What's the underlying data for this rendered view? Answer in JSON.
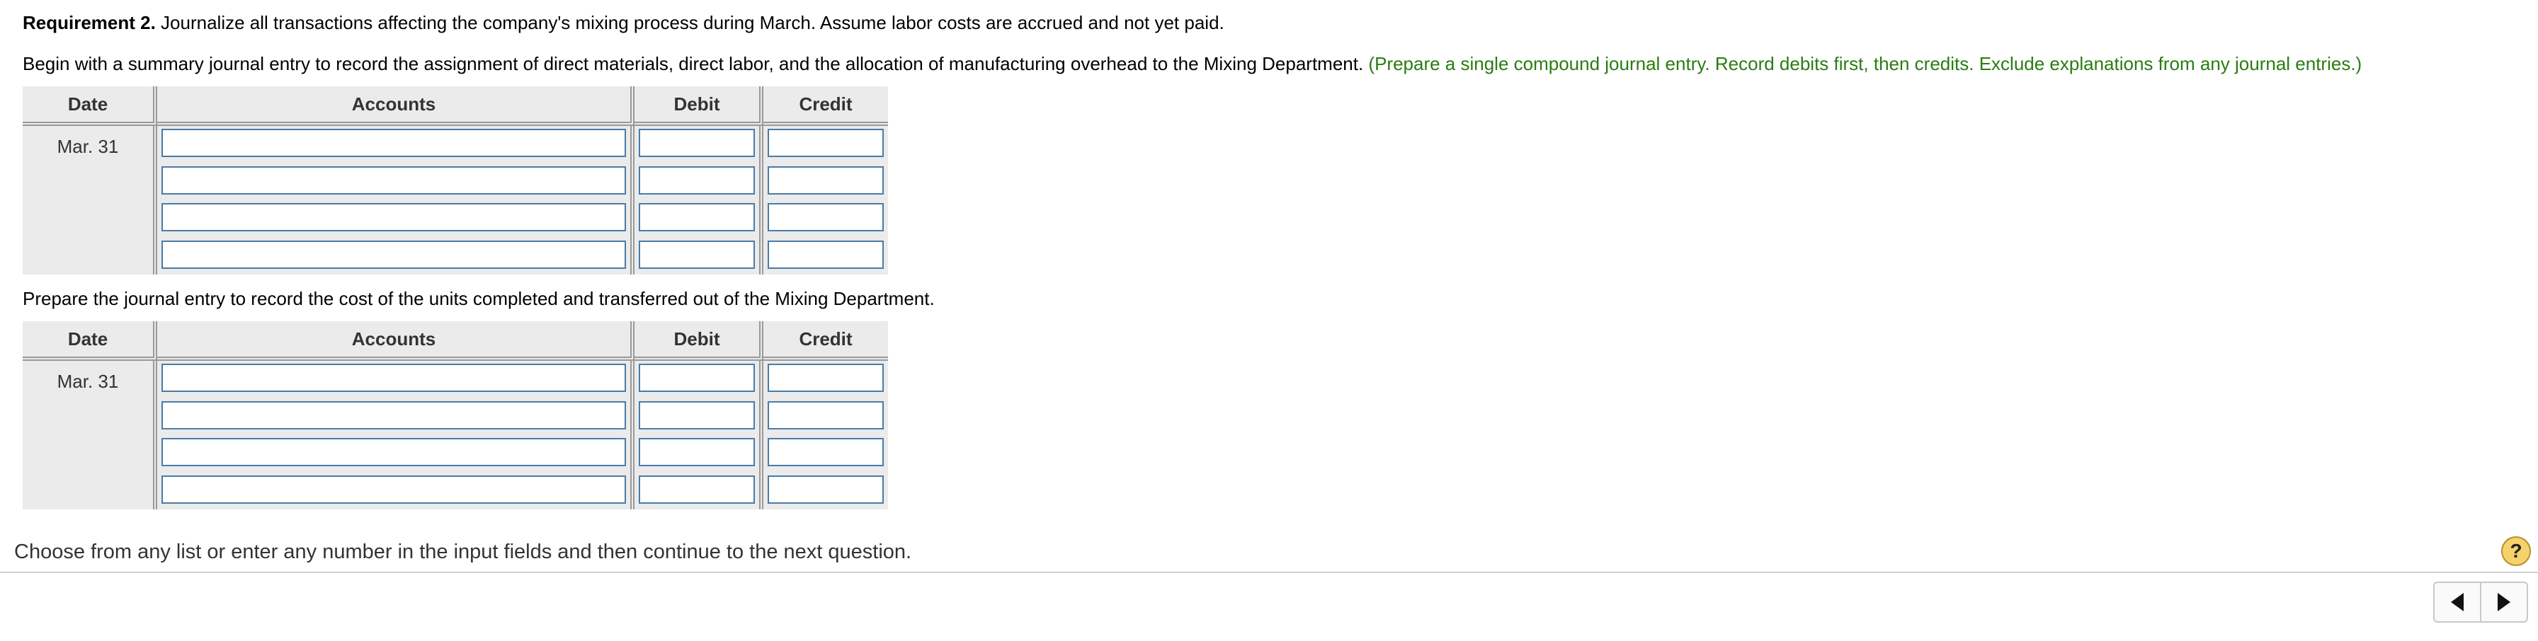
{
  "requirement": {
    "label": "Requirement 2.",
    "text": " Journalize all transactions affecting the company's mixing process during March. Assume labor costs are accrued and not yet paid."
  },
  "entry1": {
    "instruction": "Begin with a summary journal entry to record the assignment of direct materials, direct labor, and the allocation of manufacturing overhead to the Mixing Department. ",
    "hint": "(Prepare a single compound journal entry. Record debits first, then credits. Exclude explanations from any journal entries.)",
    "headers": {
      "date": "Date",
      "accounts": "Accounts",
      "debit": "Debit",
      "credit": "Credit"
    },
    "date": "Mar. 31",
    "rows": [
      {
        "account": "",
        "debit": "",
        "credit": ""
      },
      {
        "account": "",
        "debit": "",
        "credit": ""
      },
      {
        "account": "",
        "debit": "",
        "credit": ""
      },
      {
        "account": "",
        "debit": "",
        "credit": ""
      }
    ]
  },
  "entry2": {
    "instruction": "Prepare the journal entry to record the cost of the units completed and transferred out of the Mixing Department.",
    "headers": {
      "date": "Date",
      "accounts": "Accounts",
      "debit": "Debit",
      "credit": "Credit"
    },
    "date": "Mar. 31",
    "rows": [
      {
        "account": "",
        "debit": "",
        "credit": ""
      },
      {
        "account": "",
        "debit": "",
        "credit": ""
      },
      {
        "account": "",
        "debit": "",
        "credit": ""
      },
      {
        "account": "",
        "debit": "",
        "credit": ""
      }
    ]
  },
  "footer": {
    "text": "Choose from any list or enter any number in the input fields and then continue to the next question.",
    "help_label": "?",
    "help_icon": "help-icon",
    "prev_icon": "triangle-left-icon",
    "next_icon": "triangle-right-icon"
  },
  "colors": {
    "hint": "#2a7c12",
    "input_border": "#4a7ba7",
    "table_bg": "#ebebeb"
  }
}
